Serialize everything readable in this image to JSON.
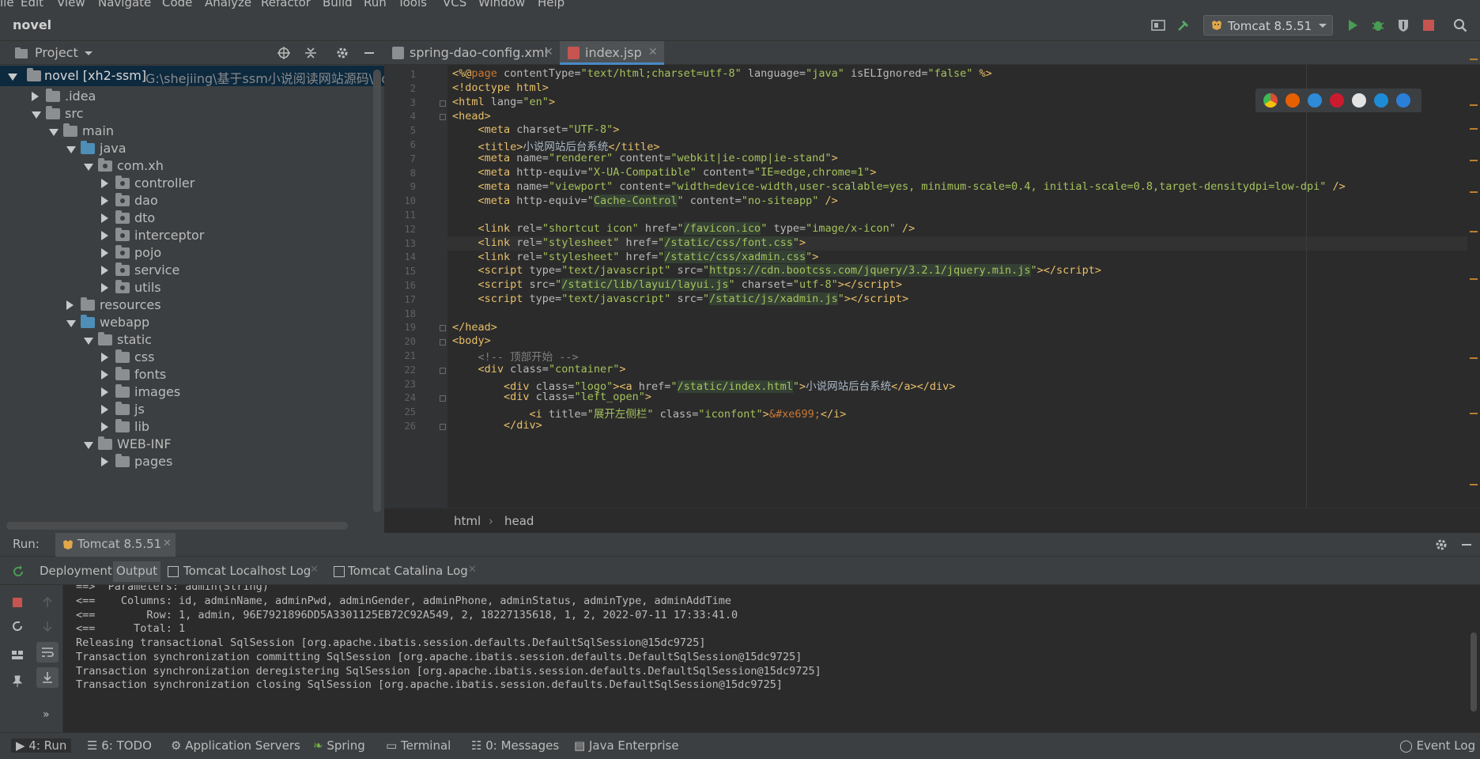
{
  "menu": {
    "items": [
      "ile",
      "Edit",
      "View",
      "Navigate",
      "Code",
      "Analyze",
      "Refactor",
      "Build",
      "Run",
      "Tools",
      "VCS",
      "Window",
      "Help"
    ]
  },
  "navbar": {
    "project": "novel",
    "run_config": "Tomcat 8.5.51",
    "icons": [
      "layout-icon",
      "hammer-icon",
      "run-icon",
      "debug-icon",
      "coverage-icon",
      "stop-icon",
      "search-icon"
    ]
  },
  "project_panel": {
    "title": "Project",
    "root": {
      "label": "novel [xh2-ssm]",
      "path": "G:\\shejiing\\基于ssm小说阅读网站源码\\nove"
    },
    "tree": [
      {
        "label": ".idea",
        "depth": 1,
        "expanded": false,
        "kind": "folder"
      },
      {
        "label": "src",
        "depth": 1,
        "expanded": true,
        "kind": "folder"
      },
      {
        "label": "main",
        "depth": 2,
        "expanded": true,
        "kind": "folder"
      },
      {
        "label": "java",
        "depth": 3,
        "expanded": true,
        "kind": "source"
      },
      {
        "label": "com.xh",
        "depth": 4,
        "expanded": true,
        "kind": "package"
      },
      {
        "label": "controller",
        "depth": 5,
        "expanded": false,
        "kind": "package"
      },
      {
        "label": "dao",
        "depth": 5,
        "expanded": false,
        "kind": "package"
      },
      {
        "label": "dto",
        "depth": 5,
        "expanded": false,
        "kind": "package"
      },
      {
        "label": "interceptor",
        "depth": 5,
        "expanded": false,
        "kind": "package"
      },
      {
        "label": "pojo",
        "depth": 5,
        "expanded": false,
        "kind": "package"
      },
      {
        "label": "service",
        "depth": 5,
        "expanded": false,
        "kind": "package"
      },
      {
        "label": "utils",
        "depth": 5,
        "expanded": false,
        "kind": "package"
      },
      {
        "label": "resources",
        "depth": 3,
        "expanded": false,
        "kind": "folder"
      },
      {
        "label": "webapp",
        "depth": 3,
        "expanded": true,
        "kind": "web"
      },
      {
        "label": "static",
        "depth": 4,
        "expanded": true,
        "kind": "folder"
      },
      {
        "label": "css",
        "depth": 5,
        "expanded": false,
        "kind": "folder"
      },
      {
        "label": "fonts",
        "depth": 5,
        "expanded": false,
        "kind": "folder"
      },
      {
        "label": "images",
        "depth": 5,
        "expanded": false,
        "kind": "folder"
      },
      {
        "label": "js",
        "depth": 5,
        "expanded": false,
        "kind": "folder"
      },
      {
        "label": "lib",
        "depth": 5,
        "expanded": false,
        "kind": "folder"
      },
      {
        "label": "WEB-INF",
        "depth": 4,
        "expanded": true,
        "kind": "folder"
      },
      {
        "label": "pages",
        "depth": 5,
        "expanded": false,
        "kind": "folder"
      }
    ]
  },
  "editor": {
    "tabs": [
      {
        "label": "spring-dao-config.xml",
        "active": false
      },
      {
        "label": "index.jsp",
        "active": true
      }
    ],
    "breadcrumbs": [
      "html",
      "head"
    ],
    "line_numbers": [
      "1",
      "2",
      "3",
      "4",
      "5",
      "6",
      "7",
      "8",
      "9",
      "10",
      "11",
      "12",
      "13",
      "14",
      "15",
      "16",
      "17",
      "18",
      "19",
      "20",
      "21",
      "22",
      "23",
      "24",
      "25",
      "26"
    ]
  },
  "run_panel": {
    "label": "Run:",
    "config_tab": "Tomcat 8.5.51",
    "subtabs": [
      "Deployment",
      "Output",
      "Tomcat Localhost Log",
      "Tomcat Catalina Log"
    ],
    "console": [
      "==>  Parameters: admin(String)",
      "<==    Columns: id, adminName, adminPwd, adminGender, adminPhone, adminStatus, adminType, adminAddTime",
      "<==        Row: 1, admin, 96E7921896DD5A3301125EB72C92A549, 2, 18227135618, 1, 2, 2022-07-11 17:33:41.0",
      "<==      Total: 1",
      "Releasing transactional SqlSession [org.apache.ibatis.session.defaults.DefaultSqlSession@15dc9725]",
      "Transaction synchronization committing SqlSession [org.apache.ibatis.session.defaults.DefaultSqlSession@15dc9725]",
      "Transaction synchronization deregistering SqlSession [org.apache.ibatis.session.defaults.DefaultSqlSession@15dc9725]",
      "Transaction synchronization closing SqlSession [org.apache.ibatis.session.defaults.DefaultSqlSession@15dc9725]"
    ]
  },
  "statusbar": {
    "items": [
      "4: Run",
      "6: TODO",
      "Application Servers",
      "Spring",
      "Terminal",
      "0: Messages",
      "Java Enterprise"
    ],
    "event_log": "Event Log"
  },
  "colors": {
    "background": "#2b2b2b",
    "panel": "#3c3f41",
    "tag": "#e8bf6a",
    "string": "#a5c25c",
    "selection": "#0d293e",
    "accent": "#4a88c7"
  }
}
